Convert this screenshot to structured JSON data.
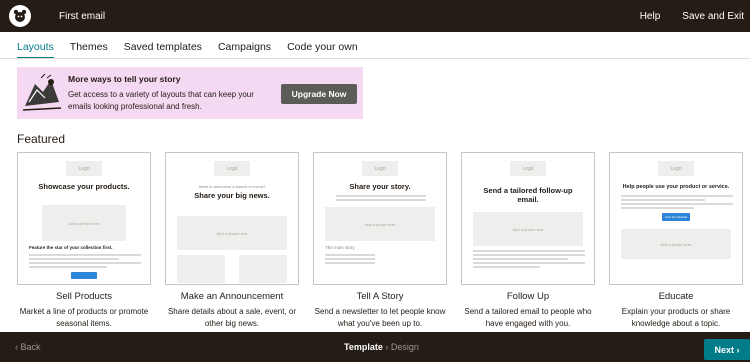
{
  "topbar": {
    "logo_icon": "mailchimp-icon",
    "title": "First email",
    "help_label": "Help",
    "save_exit_label": "Save and Exit"
  },
  "tabs": [
    {
      "label": "Layouts",
      "active": true
    },
    {
      "label": "Themes",
      "active": false
    },
    {
      "label": "Saved templates",
      "active": false
    },
    {
      "label": "Campaigns",
      "active": false
    },
    {
      "label": "Code your own",
      "active": false
    }
  ],
  "promo": {
    "heading": "More ways to tell your story",
    "body": "Get access to a variety of layouts that can keep your emails looking professional and fresh.",
    "button_label": "Upgrade Now"
  },
  "featured_heading": "Featured",
  "cards": [
    {
      "title": "Sell Products",
      "description": "Market a line of products or promote seasonal items.",
      "thumb": {
        "logo": "Logo",
        "headline": "Showcase your products.",
        "photo": "Add a photo here",
        "subhead": "Feature the star of your collection first."
      }
    },
    {
      "title": "Make an Announcement",
      "description": "Share details about a sale, event, or other big news.",
      "thumb": {
        "logo": "Logo",
        "kicker": "Want to announce a launch or event?",
        "headline": "Share your big news.",
        "photo": "Add a photo here"
      }
    },
    {
      "title": "Tell A Story",
      "description": "Send a newsletter to let people know what you've been up to.",
      "thumb": {
        "logo": "Logo",
        "headline": "Share your story.",
        "photo": "Add a photo here",
        "subhead": "The main story"
      }
    },
    {
      "title": "Follow Up",
      "description": "Send a tailored email to people who have engaged with you.",
      "thumb": {
        "logo": "Logo",
        "headline": "Send a tailored follow-up email.",
        "photo": "Add a photo here"
      }
    },
    {
      "title": "Educate",
      "description": "Explain your products or share knowledge about a topic.",
      "thumb": {
        "logo": "Logo",
        "headline": "Help people use your product or service.",
        "button": "Let's Get Started",
        "photo": "Add a photo here"
      }
    }
  ],
  "footer": {
    "back_label": "Back",
    "step_active": "Template",
    "step_next": "Design",
    "next_label": "Next"
  },
  "colors": {
    "topbar": "#241c15",
    "accent": "#007c89",
    "promo_bg": "#f5d9f3"
  }
}
